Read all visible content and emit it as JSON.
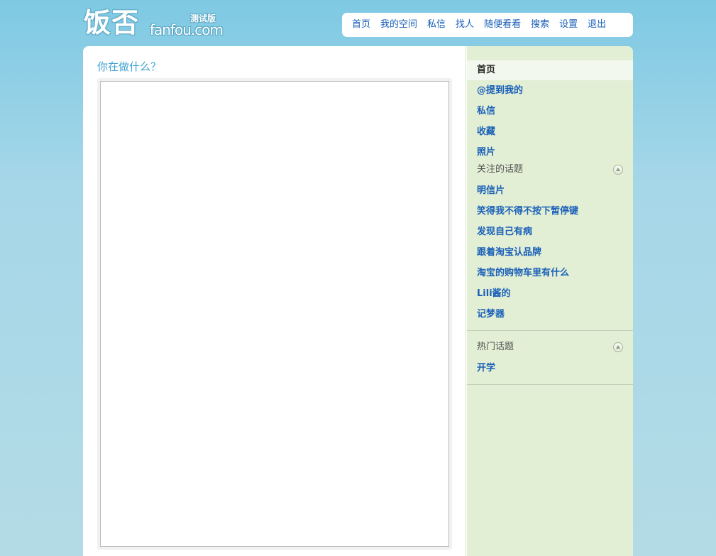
{
  "logo": {
    "mark": "饭否",
    "domain": "fanfou.com",
    "beta": "测试版"
  },
  "topnav": {
    "items": [
      "首页",
      "我的空间",
      "私信",
      "找人",
      "随便看看",
      "搜索",
      "设置",
      "退出"
    ]
  },
  "composer": {
    "prompt": "你在做什么？",
    "value": ""
  },
  "sidebar": {
    "menu": [
      "首页",
      "@提到我的",
      "私信",
      "收藏",
      "照片"
    ],
    "followed_topics": {
      "title": "关注的话题",
      "items": [
        "明信片",
        "笑得我不得不按下暂停键",
        "发现自己有病",
        "跟着淘宝认品牌",
        "淘宝的购物车里有什么",
        "Lili酱的",
        "记梦器"
      ]
    },
    "hot_topics": {
      "title": "热门话题",
      "items": [
        "开学"
      ]
    }
  },
  "colors": {
    "link": "#1a60b8",
    "prompt": "#3ea2d2",
    "sidebar_bg": "#e2efd5",
    "page_bg": "#a6d7e8"
  }
}
